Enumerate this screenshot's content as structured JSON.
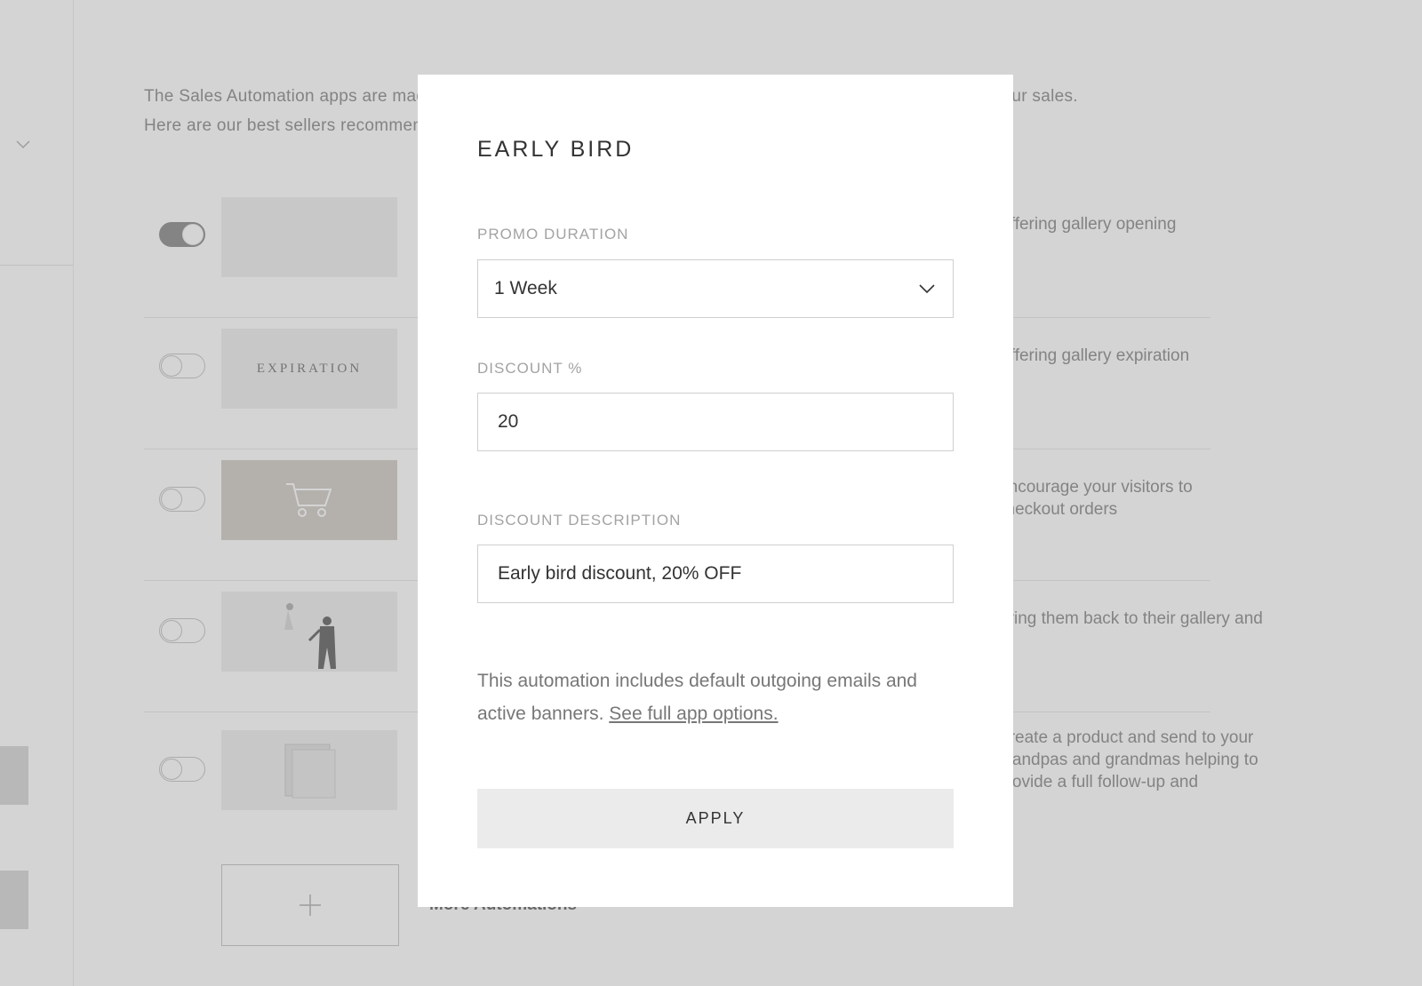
{
  "background": {
    "intro_line1": "The Sales Automation apps are made to help you automate your gallery and help you save time and increase your sales.",
    "intro_line2": "Here are our best sellers recommended to get started:",
    "rows": [
      {
        "thumb_text": "",
        "desc": "Offering gallery opening",
        "enabled": true
      },
      {
        "thumb_text": "EXPIRATION",
        "desc": "Offering gallery expiration",
        "enabled": false
      },
      {
        "thumb_text": "",
        "desc": "Encourage your visitors to checkout orders",
        "enabled": false
      },
      {
        "thumb_text": "",
        "desc": "Bring them back to their gallery and",
        "enabled": false
      },
      {
        "thumb_text": "",
        "desc": "Create a product and send to your grandpas and grandmas helping to provide a full follow-up and",
        "enabled": false
      }
    ],
    "more_label": "More Automations"
  },
  "modal": {
    "title": "EARLY BIRD",
    "promo_duration": {
      "label": "PROMO DURATION",
      "value": "1 Week"
    },
    "discount_percent": {
      "label": "DISCOUNT %",
      "value": "20"
    },
    "discount_description": {
      "label": "DISCOUNT DESCRIPTION",
      "value": "Early bird discount, 20% OFF"
    },
    "info_text": "This automation includes default outgoing emails and active banners.",
    "info_link": "See full app options.",
    "apply_label": "APPLY"
  },
  "colors": {
    "overlay": "#282828",
    "modal_bg": "#ffffff",
    "button_bg": "#ebebeb",
    "label": "#a3a3a3"
  }
}
